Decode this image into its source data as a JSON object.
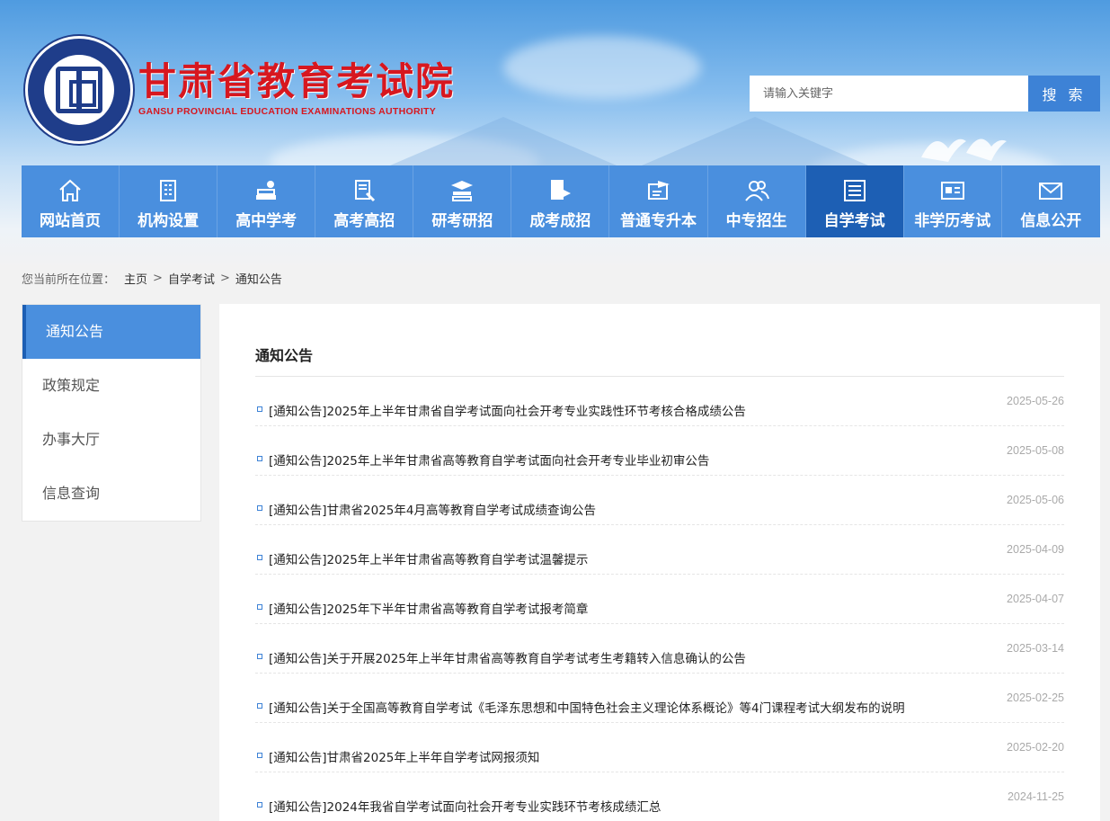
{
  "header": {
    "logo_cn": "甘肃省教育考试院",
    "logo_en": "GANSU PROVINCIAL EDUCATION EXAMINATIONS AUTHORITY",
    "seal_icon": "gansu-exam-seal"
  },
  "search": {
    "placeholder": "请输入关键字",
    "button_label": "搜 索"
  },
  "nav": {
    "items": [
      {
        "label": "网站首页",
        "icon": "home-icon"
      },
      {
        "label": "机构设置",
        "icon": "building-icon"
      },
      {
        "label": "高中学考",
        "icon": "books-icon"
      },
      {
        "label": "高考高招",
        "icon": "exam-pen-icon"
      },
      {
        "label": "研考研招",
        "icon": "graduation-books-icon"
      },
      {
        "label": "成考成招",
        "icon": "document-flag-icon"
      },
      {
        "label": "普通专升本",
        "icon": "cap-board-icon"
      },
      {
        "label": "中专招生",
        "icon": "users-icon"
      },
      {
        "label": "自学考试",
        "icon": "list-doc-icon",
        "active": true
      },
      {
        "label": "非学历考试",
        "icon": "id-card-icon"
      },
      {
        "label": "信息公开",
        "icon": "mail-icon"
      }
    ],
    "active_color": "#1d5fb4",
    "base_color": "#4a8fde"
  },
  "breadcrumb": {
    "prefix": "您当前所在位置：",
    "items": [
      "主页",
      "自学考试",
      "通知公告"
    ],
    "separator": ">"
  },
  "sidebar": {
    "items": [
      {
        "label": "通知公告",
        "active": true
      },
      {
        "label": "政策规定"
      },
      {
        "label": "办事大厅"
      },
      {
        "label": "信息查询"
      }
    ]
  },
  "main": {
    "title": "通知公告",
    "news": [
      {
        "title": "[通知公告]2025年上半年甘肃省自学考试面向社会开考专业实践性环节考核合格成绩公告",
        "date": "2025-05-26"
      },
      {
        "title": "[通知公告]2025年上半年甘肃省高等教育自学考试面向社会开考专业毕业初审公告",
        "date": "2025-05-08"
      },
      {
        "title": "[通知公告]甘肃省2025年4月高等教育自学考试成绩查询公告",
        "date": "2025-05-06"
      },
      {
        "title": "[通知公告]2025年上半年甘肃省高等教育自学考试温馨提示",
        "date": "2025-04-09"
      },
      {
        "title": "[通知公告]2025年下半年甘肃省高等教育自学考试报考简章",
        "date": "2025-04-07"
      },
      {
        "title": "[通知公告]关于开展2025年上半年甘肃省高等教育自学考试考生考籍转入信息确认的公告",
        "date": "2025-03-14"
      },
      {
        "title": "[通知公告]关于全国高等教育自学考试《毛泽东思想和中国特色社会主义理论体系概论》等4门课程考试大纲发布的说明",
        "date": "2025-02-25"
      },
      {
        "title": "[通知公告]甘肃省2025年上半年自学考试网报须知",
        "date": "2025-02-20"
      },
      {
        "title": "[通知公告]2024年我省自学考试面向社会开考专业实践环节考核成绩汇总",
        "date": "2024-11-25"
      }
    ]
  }
}
